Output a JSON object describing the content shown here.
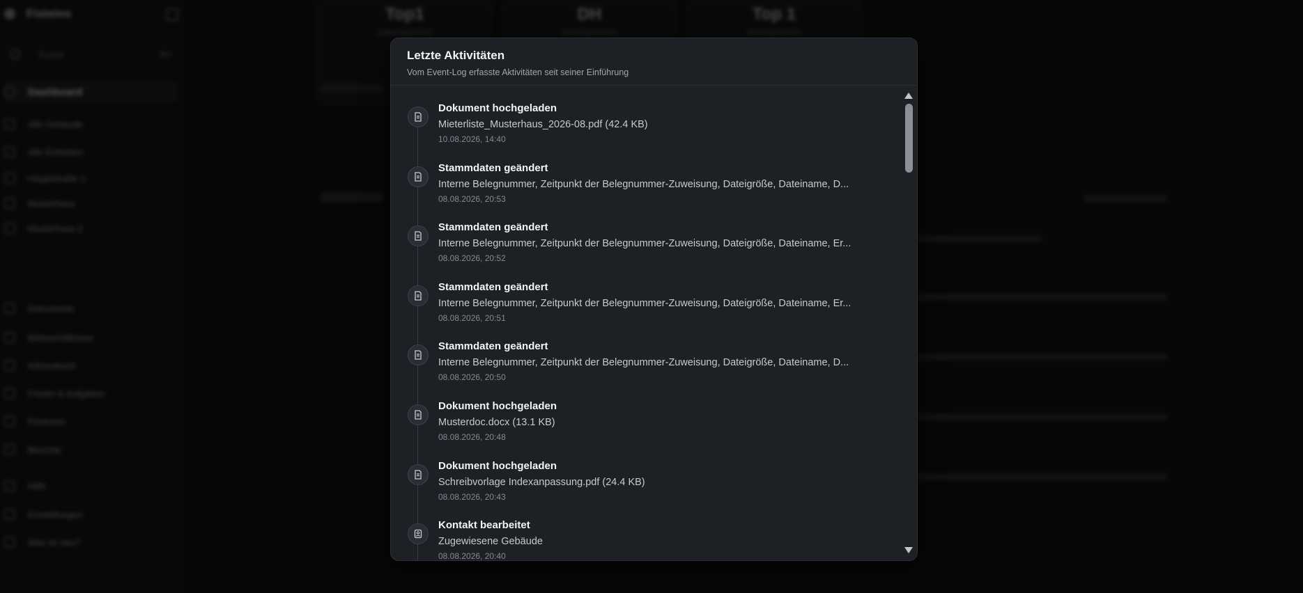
{
  "background": {
    "app_name": "Fisteins",
    "search_placeholder": "Suche",
    "search_shortcut": "⌘K",
    "nav": [
      {
        "label": "Dashboard",
        "active": true
      },
      {
        "label": "Alle Gebäude"
      },
      {
        "label": "Alle Einheiten"
      },
      {
        "label": "Hauptstraße 1"
      },
      {
        "label": "Musterhaus"
      },
      {
        "label": "Musterhaus 2"
      }
    ],
    "nav_bottom": [
      {
        "label": "Dokumente"
      },
      {
        "label": "Mietverhältnisse"
      },
      {
        "label": "Adressbuch"
      },
      {
        "label": "Fristen & Aufgaben"
      },
      {
        "label": "Finanzen"
      },
      {
        "label": "Berichte"
      },
      {
        "label": "Hilfe"
      },
      {
        "label": "Einstellungen"
      },
      {
        "label": "Was ist neu?"
      }
    ],
    "kpis": [
      {
        "value": "Top1",
        "label": "Gebäudeanzahl"
      },
      {
        "value": "DH",
        "label": "Gebäudeanzahl"
      },
      {
        "value": "Top 1",
        "label": "Gebäudeanzahl"
      }
    ]
  },
  "modal": {
    "title": "Letzte Aktivitäten",
    "subtitle": "Vom Event-Log erfasste Aktivitäten seit seiner Einführung",
    "items": [
      {
        "icon": "document-icon",
        "title": "Dokument hochgeladen",
        "detail": "Mieterliste_Musterhaus_2026-08.pdf (42.4 KB)",
        "timestamp": "10.08.2026, 14:40"
      },
      {
        "icon": "document-icon",
        "title": "Stammdaten geändert",
        "detail": "Interne Belegnummer, Zeitpunkt der Belegnummer-Zuweisung, Dateigröße, Dateiname, D...",
        "timestamp": "08.08.2026, 20:53"
      },
      {
        "icon": "document-icon",
        "title": "Stammdaten geändert",
        "detail": "Interne Belegnummer, Zeitpunkt der Belegnummer-Zuweisung, Dateigröße, Dateiname, Er...",
        "timestamp": "08.08.2026, 20:52"
      },
      {
        "icon": "document-icon",
        "title": "Stammdaten geändert",
        "detail": "Interne Belegnummer, Zeitpunkt der Belegnummer-Zuweisung, Dateigröße, Dateiname, Er...",
        "timestamp": "08.08.2026, 20:51"
      },
      {
        "icon": "document-icon",
        "title": "Stammdaten geändert",
        "detail": "Interne Belegnummer, Zeitpunkt der Belegnummer-Zuweisung, Dateigröße, Dateiname, D...",
        "timestamp": "08.08.2026, 20:50"
      },
      {
        "icon": "document-icon",
        "title": "Dokument hochgeladen",
        "detail": "Musterdoc.docx (13.1 KB)",
        "timestamp": "08.08.2026, 20:48"
      },
      {
        "icon": "document-icon",
        "title": "Dokument hochgeladen",
        "detail": "Schreibvorlage Indexanpassung.pdf (24.4 KB)",
        "timestamp": "08.08.2026, 20:43"
      },
      {
        "icon": "contact-icon",
        "title": "Kontakt bearbeitet",
        "detail": "Zugewiesene Gebäude",
        "timestamp": "08.08.2026, 20:40"
      }
    ]
  }
}
